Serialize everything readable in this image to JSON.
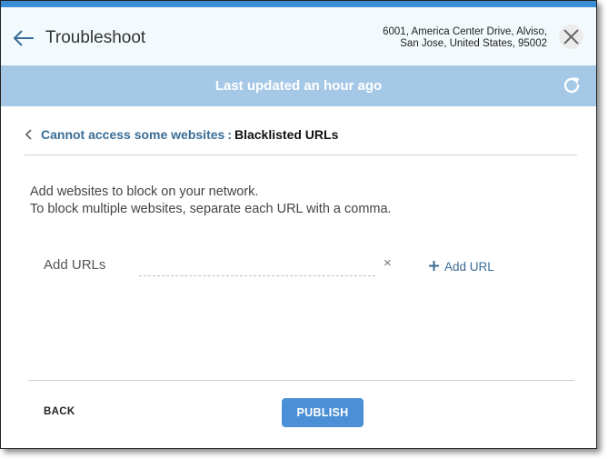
{
  "header": {
    "title": "Troubleshoot",
    "address_line1": "6001, America Center Drive, Alviso,",
    "address_line2": "San Jose, United States, 95002",
    "back_icon": "arrow-left-icon",
    "close_icon": "close-icon"
  },
  "status": {
    "text": "Last updated an hour ago",
    "refresh_icon": "refresh-icon"
  },
  "breadcrumb": {
    "parent": "Cannot access some websites",
    "separator": ":",
    "current": "Blacklisted URLs"
  },
  "instructions": {
    "line1": "Add websites to block on your network.",
    "line2": "To block multiple websites, separate each URL with a comma."
  },
  "url_form": {
    "label": "Add URLs",
    "value": "",
    "placeholder": "",
    "clear_label": "×",
    "add_label": "Add URL"
  },
  "footer": {
    "back_label": "BACK",
    "publish_label": "PUBLISH"
  },
  "colors": {
    "accent": "#3a8ed6",
    "status_bar": "#a5c8e6",
    "link": "#3a6d96",
    "publish": "#4b8fd6"
  }
}
